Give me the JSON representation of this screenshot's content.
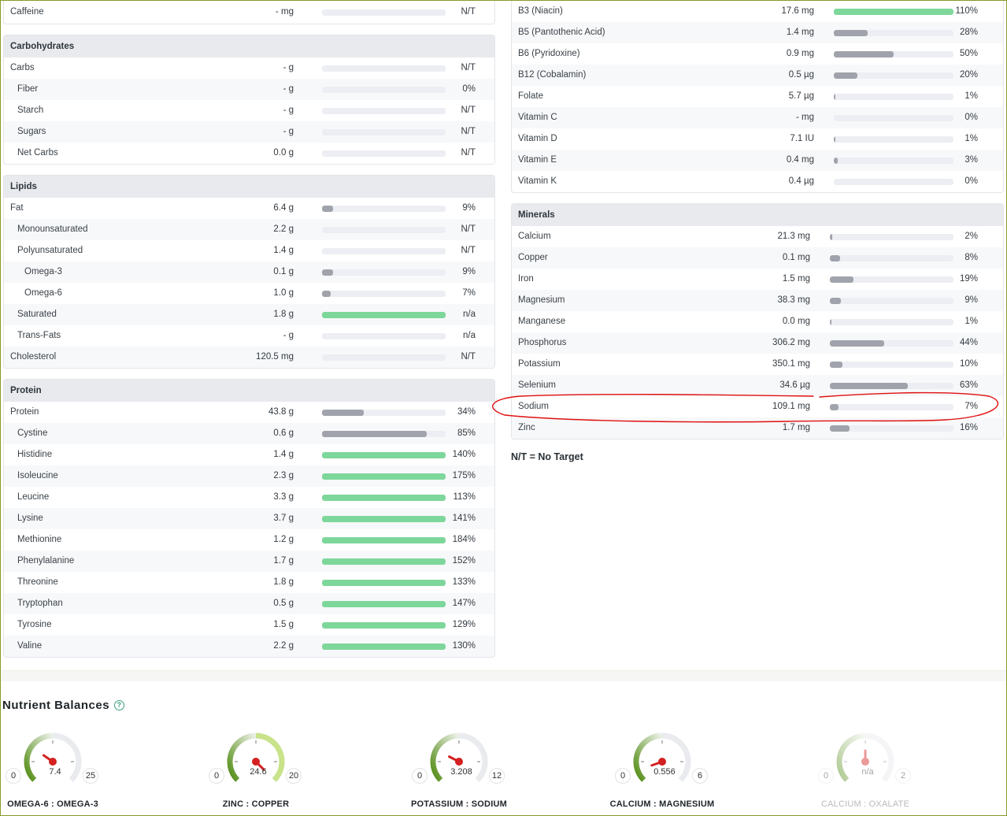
{
  "left": {
    "caffeine": {
      "name": "Caffeine",
      "amount": "- mg",
      "pct": "N/T",
      "fill": 0,
      "green": false
    },
    "carbohydrates": {
      "title": "Carbohydrates",
      "rows": [
        {
          "name": "Carbs",
          "amount": "- g",
          "pct": "N/T",
          "fill": 0,
          "green": false,
          "indent": 0
        },
        {
          "name": "Fiber",
          "amount": "- g",
          "pct": "0%",
          "fill": 0,
          "green": false,
          "indent": 1
        },
        {
          "name": "Starch",
          "amount": "- g",
          "pct": "N/T",
          "fill": 0,
          "green": false,
          "indent": 1
        },
        {
          "name": "Sugars",
          "amount": "- g",
          "pct": "N/T",
          "fill": 0,
          "green": false,
          "indent": 1
        },
        {
          "name": "Net Carbs",
          "amount": "0.0 g",
          "pct": "N/T",
          "fill": 0,
          "green": false,
          "indent": 1
        }
      ]
    },
    "lipids": {
      "title": "Lipids",
      "rows": [
        {
          "name": "Fat",
          "amount": "6.4 g",
          "pct": "9%",
          "fill": 0.09,
          "green": false,
          "indent": 0
        },
        {
          "name": "Monounsaturated",
          "amount": "2.2 g",
          "pct": "N/T",
          "fill": 0,
          "green": false,
          "indent": 1
        },
        {
          "name": "Polyunsaturated",
          "amount": "1.4 g",
          "pct": "N/T",
          "fill": 0,
          "green": false,
          "indent": 1
        },
        {
          "name": "Omega-3",
          "amount": "0.1 g",
          "pct": "9%",
          "fill": 0.09,
          "green": false,
          "indent": 2
        },
        {
          "name": "Omega-6",
          "amount": "1.0 g",
          "pct": "7%",
          "fill": 0.07,
          "green": false,
          "indent": 2
        },
        {
          "name": "Saturated",
          "amount": "1.8 g",
          "pct": "n/a",
          "fill": 1,
          "green": true,
          "indent": 1
        },
        {
          "name": "Trans-Fats",
          "amount": "- g",
          "pct": "n/a",
          "fill": 0,
          "green": false,
          "indent": 1
        },
        {
          "name": "Cholesterol",
          "amount": "120.5 mg",
          "pct": "N/T",
          "fill": 0,
          "green": false,
          "indent": 0
        }
      ]
    },
    "protein": {
      "title": "Protein",
      "rows": [
        {
          "name": "Protein",
          "amount": "43.8 g",
          "pct": "34%",
          "fill": 0.34,
          "green": false,
          "indent": 0
        },
        {
          "name": "Cystine",
          "amount": "0.6 g",
          "pct": "85%",
          "fill": 0.85,
          "green": false,
          "indent": 1
        },
        {
          "name": "Histidine",
          "amount": "1.4 g",
          "pct": "140%",
          "fill": 1,
          "green": true,
          "indent": 1
        },
        {
          "name": "Isoleucine",
          "amount": "2.3 g",
          "pct": "175%",
          "fill": 1,
          "green": true,
          "indent": 1
        },
        {
          "name": "Leucine",
          "amount": "3.3 g",
          "pct": "113%",
          "fill": 1,
          "green": true,
          "indent": 1
        },
        {
          "name": "Lysine",
          "amount": "3.7 g",
          "pct": "141%",
          "fill": 1,
          "green": true,
          "indent": 1
        },
        {
          "name": "Methionine",
          "amount": "1.2 g",
          "pct": "184%",
          "fill": 1,
          "green": true,
          "indent": 1
        },
        {
          "name": "Phenylalanine",
          "amount": "1.7 g",
          "pct": "152%",
          "fill": 1,
          "green": true,
          "indent": 1
        },
        {
          "name": "Threonine",
          "amount": "1.8 g",
          "pct": "133%",
          "fill": 1,
          "green": true,
          "indent": 1
        },
        {
          "name": "Tryptophan",
          "amount": "0.5 g",
          "pct": "147%",
          "fill": 1,
          "green": true,
          "indent": 1
        },
        {
          "name": "Tyrosine",
          "amount": "1.5 g",
          "pct": "129%",
          "fill": 1,
          "green": true,
          "indent": 1
        },
        {
          "name": "Valine",
          "amount": "2.2 g",
          "pct": "130%",
          "fill": 1,
          "green": true,
          "indent": 1
        }
      ]
    }
  },
  "right": {
    "vitamins": {
      "rows": [
        {
          "name": "B3 (Niacin)",
          "amount": "17.6 mg",
          "pct": "110%",
          "fill": 1,
          "green": true
        },
        {
          "name": "B5 (Pantothenic Acid)",
          "amount": "1.4 mg",
          "pct": "28%",
          "fill": 0.28,
          "green": false
        },
        {
          "name": "B6 (Pyridoxine)",
          "amount": "0.9 mg",
          "pct": "50%",
          "fill": 0.5,
          "green": false
        },
        {
          "name": "B12 (Cobalamin)",
          "amount": "0.5 µg",
          "pct": "20%",
          "fill": 0.2,
          "green": false
        },
        {
          "name": "Folate",
          "amount": "5.7 µg",
          "pct": "1%",
          "fill": 0.01,
          "green": false
        },
        {
          "name": "Vitamin C",
          "amount": "- mg",
          "pct": "0%",
          "fill": 0,
          "green": false
        },
        {
          "name": "Vitamin D",
          "amount": "7.1 IU",
          "pct": "1%",
          "fill": 0.01,
          "green": false
        },
        {
          "name": "Vitamin E",
          "amount": "0.4 mg",
          "pct": "3%",
          "fill": 0.03,
          "green": false
        },
        {
          "name": "Vitamin K",
          "amount": "0.4 µg",
          "pct": "0%",
          "fill": 0,
          "green": false
        }
      ]
    },
    "minerals": {
      "title": "Minerals",
      "rows": [
        {
          "name": "Calcium",
          "amount": "21.3 mg",
          "pct": "2%",
          "fill": 0.02,
          "green": false
        },
        {
          "name": "Copper",
          "amount": "0.1 mg",
          "pct": "8%",
          "fill": 0.08,
          "green": false
        },
        {
          "name": "Iron",
          "amount": "1.5 mg",
          "pct": "19%",
          "fill": 0.19,
          "green": false
        },
        {
          "name": "Magnesium",
          "amount": "38.3 mg",
          "pct": "9%",
          "fill": 0.09,
          "green": false
        },
        {
          "name": "Manganese",
          "amount": "0.0 mg",
          "pct": "1%",
          "fill": 0.01,
          "green": false
        },
        {
          "name": "Phosphorus",
          "amount": "306.2 mg",
          "pct": "44%",
          "fill": 0.44,
          "green": false
        },
        {
          "name": "Potassium",
          "amount": "350.1 mg",
          "pct": "10%",
          "fill": 0.1,
          "green": false
        },
        {
          "name": "Selenium",
          "amount": "34.6 µg",
          "pct": "63%",
          "fill": 0.63,
          "green": false
        },
        {
          "name": "Sodium",
          "amount": "109.1 mg",
          "pct": "7%",
          "fill": 0.07,
          "green": false
        },
        {
          "name": "Zinc",
          "amount": "1.7 mg",
          "pct": "16%",
          "fill": 0.16,
          "green": false
        }
      ]
    },
    "note": "N/T = No Target"
  },
  "balances": {
    "title": "Nutrient Balances",
    "help_icon": "?",
    "gauges": [
      {
        "name": "OMEGA-6 : OMEGA-3",
        "min": "0",
        "max": "25",
        "value": "7.4",
        "ratio": 0.296,
        "disabled": false
      },
      {
        "name": "ZINC : COPPER",
        "min": "0",
        "max": "20",
        "value": "24.6",
        "ratio": 1.0,
        "disabled": false
      },
      {
        "name": "POTASSIUM : SODIUM",
        "min": "0",
        "max": "12",
        "value": "3.208",
        "ratio": 0.267,
        "disabled": false
      },
      {
        "name": "CALCIUM : MAGNESIUM",
        "min": "0",
        "max": "6",
        "value": "0.556",
        "ratio": 0.093,
        "disabled": false
      },
      {
        "name": "CALCIUM : OXALATE",
        "min": "0",
        "max": "2",
        "value": "n/a",
        "ratio": 0.5,
        "disabled": true
      }
    ]
  },
  "colors": {
    "bar_gray": "#a0a3ab",
    "bar_green": "#7ed79a",
    "bar_track": "#eceef3",
    "header_bg": "#e8eaee",
    "highlight_red": "#e01010",
    "needle_red": "#d42020",
    "gauge_green_dark": "#4f8a10",
    "gauge_green_light": "#c8e38a"
  }
}
